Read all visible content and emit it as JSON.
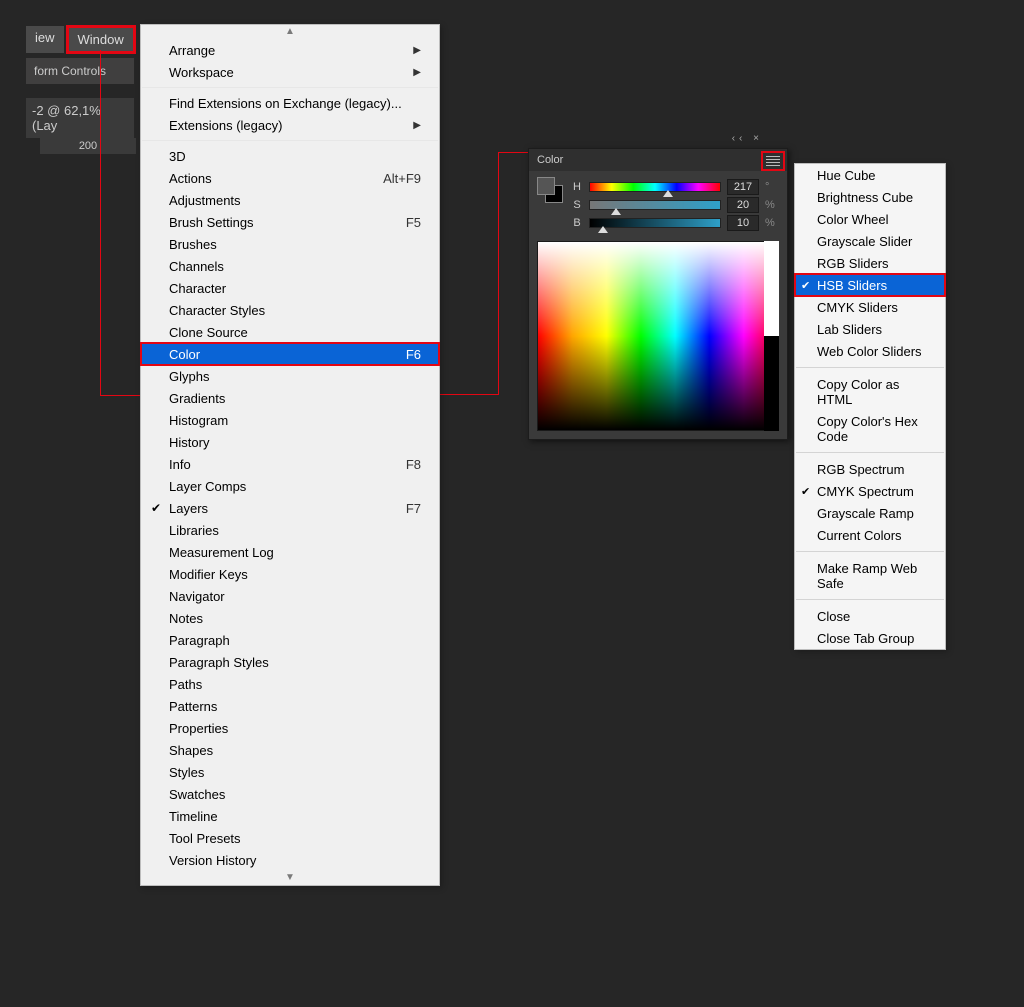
{
  "top": {
    "view_label": "iew",
    "window_label": "Window",
    "controls_label": "form Controls",
    "doc_label": "-2 @ 62,1% (Lay",
    "ruler_tick": "200"
  },
  "window_menu": {
    "items": [
      {
        "label": "Arrange",
        "submenu": true
      },
      {
        "label": "Workspace",
        "submenu": true
      },
      {
        "sep": true
      },
      {
        "label": "Find Extensions on Exchange (legacy)..."
      },
      {
        "label": "Extensions (legacy)",
        "submenu": true
      },
      {
        "sep": true
      },
      {
        "label": "3D"
      },
      {
        "label": "Actions",
        "shortcut": "Alt+F9"
      },
      {
        "label": "Adjustments"
      },
      {
        "label": "Brush Settings",
        "shortcut": "F5"
      },
      {
        "label": "Brushes"
      },
      {
        "label": "Channels"
      },
      {
        "label": "Character"
      },
      {
        "label": "Character Styles"
      },
      {
        "label": "Clone Source"
      },
      {
        "label": "Color",
        "shortcut": "F6",
        "highlight": true
      },
      {
        "label": "Glyphs"
      },
      {
        "label": "Gradients"
      },
      {
        "label": "Histogram"
      },
      {
        "label": "History"
      },
      {
        "label": "Info",
        "shortcut": "F8"
      },
      {
        "label": "Layer Comps"
      },
      {
        "label": "Layers",
        "shortcut": "F7",
        "checked": true
      },
      {
        "label": "Libraries"
      },
      {
        "label": "Measurement Log"
      },
      {
        "label": "Modifier Keys"
      },
      {
        "label": "Navigator"
      },
      {
        "label": "Notes"
      },
      {
        "label": "Paragraph"
      },
      {
        "label": "Paragraph Styles"
      },
      {
        "label": "Paths"
      },
      {
        "label": "Patterns"
      },
      {
        "label": "Properties"
      },
      {
        "label": "Shapes"
      },
      {
        "label": "Styles"
      },
      {
        "label": "Swatches"
      },
      {
        "label": "Timeline"
      },
      {
        "label": "Tool Presets"
      },
      {
        "label": "Version History"
      }
    ]
  },
  "color_panel": {
    "title": "Color",
    "h_label": "H",
    "s_label": "S",
    "b_label": "B",
    "h_value": "217",
    "s_value": "20",
    "b_value": "10",
    "h_unit": "°",
    "s_unit": "%",
    "b_unit": "%"
  },
  "panel_flyout": {
    "items": [
      {
        "label": "Hue Cube"
      },
      {
        "label": "Brightness Cube"
      },
      {
        "label": "Color Wheel"
      },
      {
        "label": "Grayscale Slider"
      },
      {
        "label": "RGB Sliders"
      },
      {
        "label": "HSB Sliders",
        "highlight": true,
        "checked": true
      },
      {
        "label": "CMYK Sliders"
      },
      {
        "label": "Lab Sliders"
      },
      {
        "label": "Web Color Sliders"
      },
      {
        "sep": true
      },
      {
        "label": "Copy Color as HTML"
      },
      {
        "label": "Copy Color's Hex Code"
      },
      {
        "sep": true
      },
      {
        "label": "RGB Spectrum"
      },
      {
        "label": "CMYK Spectrum",
        "checked": true
      },
      {
        "label": "Grayscale Ramp"
      },
      {
        "label": "Current Colors"
      },
      {
        "sep": true
      },
      {
        "label": "Make Ramp Web Safe"
      },
      {
        "sep": true
      },
      {
        "label": "Close"
      },
      {
        "label": "Close Tab Group"
      }
    ]
  }
}
